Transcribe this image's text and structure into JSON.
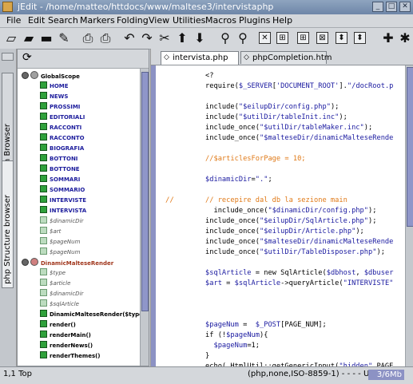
{
  "window": {
    "title": "jEdit - /home/matteo/httdocs/www/maltese3/intervistaphp"
  },
  "menu": [
    "File",
    "Edit",
    "Search",
    "Markers",
    "Folding",
    "View",
    "Utilities",
    "Macros",
    "Plugins",
    "Help"
  ],
  "side_tabs": {
    "file_system": "File System Browser",
    "structure": "php Structure browser"
  },
  "tree": {
    "root": "GlobalScope",
    "items": [
      "HOME",
      "NEWS",
      "PROSSIMI",
      "EDITORIALI",
      "RACCONTI",
      "RACCONTO",
      "BIOGRAFIA",
      "BOTTONI",
      "BOTTONE",
      "SOMMARI",
      "SOMMARIO",
      "INTERVISTE",
      "INTERVISTA",
      "$dinamicDir",
      "$art",
      "$pageNum",
      "$pageNum"
    ],
    "class_name": "DinamicMalteseRender",
    "class_items": [
      "$type",
      "$article",
      "$dinamicDir",
      "$sqlArticle",
      "DinamicMalteseRender($type",
      "render()",
      "renderMain()",
      "renderNews()",
      "renderThemes()"
    ]
  },
  "tabs": [
    "intervista.php",
    "phpCompletion.htm"
  ],
  "code_lines": [
    "<?",
    "require($_SERVER['DOCUMENT_ROOT'].\"/docRoot.p",
    "",
    "include(\"$eilupDir/config.php\");",
    "include(\"$utilDir/tableInit.inc\");",
    "include_once(\"$utilDir/tableMaker.inc\");",
    "include_once(\"$malteseDir/dinamicMalteseRende",
    "",
    "//$articlesForPage = 10;",
    "",
    "$dinamicDir=\".\";",
    "",
    "// recepire dal db la sezione main",
    "  include_once(\"$dinamicDir/config.php\");",
    "include_once(\"$eilupDir/SqlArticle.php\");",
    "include_once(\"$eilupDir/Article.php\");",
    "include_once(\"$malteseDir/dinamicMalteseRende",
    "include_once(\"$utilDir/TableDisposer.php\");",
    "",
    "$sqlArticle = new SqlArticle($dbhost, $dbuser",
    "$art = $sqlArticle->queryArticle(\"INTERVISTE\"",
    "",
    "",
    "",
    "$pageNum =  $_POST[PAGE_NUM];",
    "if (!$pageNum){",
    "  $pageNum=1;",
    "}",
    "echo( HtmlUtil::getGenericInput(\"hidden\",PAGE"
  ],
  "status": {
    "position": "1,1 Top",
    "mode": "(php,none,ISO-8859-1) - - - - U",
    "memory": "3/6Mb"
  },
  "colors": {
    "keyword": "#000000",
    "variable": "#1a1aa0",
    "string": "#1a1aa0",
    "comment": "#e07a18",
    "accent": "#8c92c4"
  }
}
